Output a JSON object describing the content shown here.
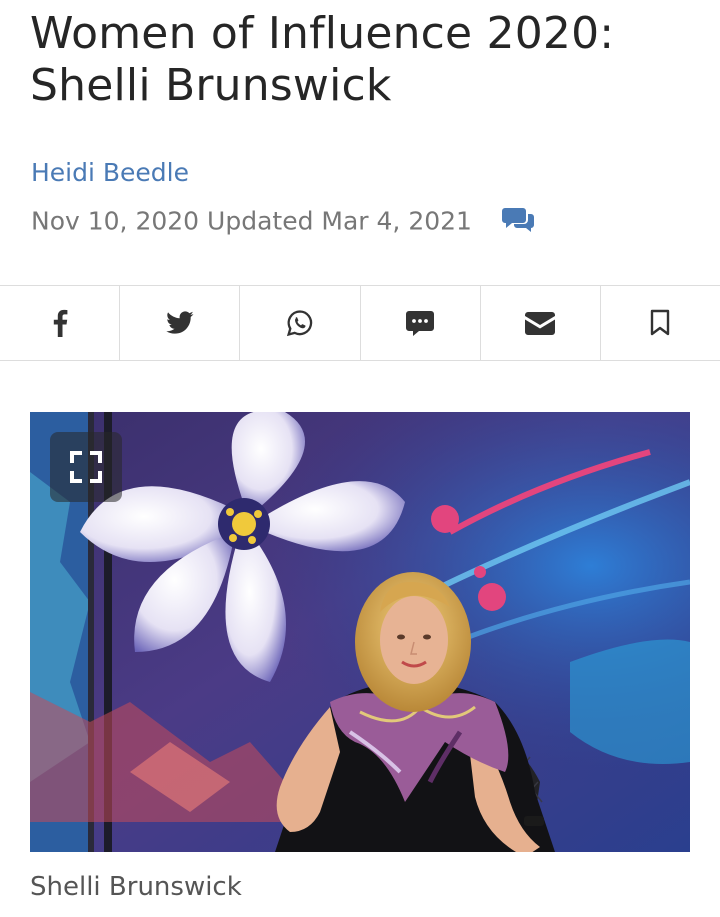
{
  "article": {
    "title": "Women of Influence 2020: Shelli Brunswick",
    "author": "Heidi Beedle",
    "published": "Nov 10, 2020",
    "updated_label": "Updated",
    "updated": "Mar 4, 2021"
  },
  "share_bar": {
    "items": [
      {
        "icon": "facebook-icon"
      },
      {
        "icon": "twitter-icon"
      },
      {
        "icon": "whatsapp-icon"
      },
      {
        "icon": "sms-icon"
      },
      {
        "icon": "email-icon"
      },
      {
        "icon": "bookmark-icon"
      }
    ],
    "icon_color": "#333333"
  },
  "photo": {
    "caption": "Shelli Brunswick"
  },
  "colors": {
    "accent": "#4a7ab5",
    "meta_text": "#777777",
    "divider": "#dddddd"
  }
}
